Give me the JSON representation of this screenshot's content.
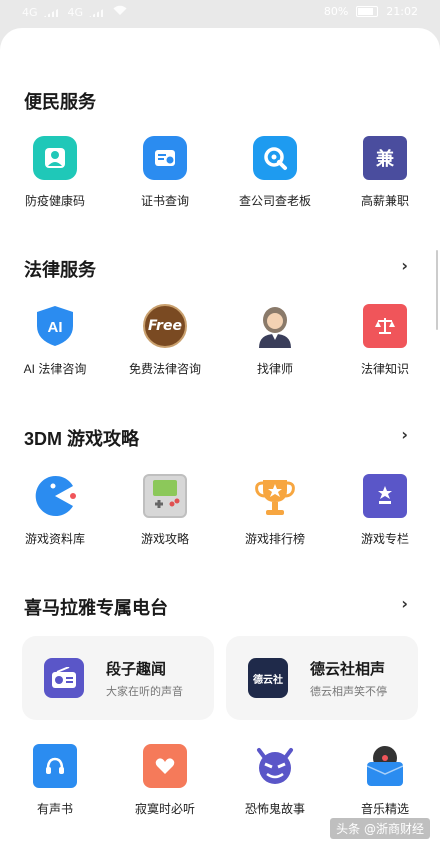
{
  "status": {
    "network": "4G",
    "network2": "4G",
    "battery": "80%",
    "time": "21:02"
  },
  "sections": {
    "service": {
      "title": "便民服务",
      "items": [
        {
          "label": "防疫健康码"
        },
        {
          "label": "证书查询"
        },
        {
          "label": "查公司查老板"
        },
        {
          "label": "高薪兼职",
          "icon_text": "兼"
        }
      ]
    },
    "legal": {
      "title": "法律服务",
      "chevron": "›",
      "items": [
        {
          "label": "AI 法律咨询",
          "icon_text": "AI"
        },
        {
          "label": "免费法律咨询",
          "icon_text": "Free"
        },
        {
          "label": "找律师"
        },
        {
          "label": "法律知识"
        }
      ]
    },
    "game": {
      "title": "3DM 游戏攻略",
      "chevron": "›",
      "items": [
        {
          "label": "游戏资料库"
        },
        {
          "label": "游戏攻略"
        },
        {
          "label": "游戏排行榜"
        },
        {
          "label": "游戏专栏"
        }
      ]
    },
    "radio": {
      "title": "喜马拉雅专属电台",
      "chevron": "›",
      "cards": [
        {
          "title": "段子趣闻",
          "subtitle": "大家在听的声音"
        },
        {
          "title": "德云社相声",
          "subtitle": "德云相声笑不停",
          "icon_text": "德云社"
        }
      ],
      "items": [
        {
          "label": "有声书"
        },
        {
          "label": "寂寞时必听"
        },
        {
          "label": "恐怖鬼故事"
        },
        {
          "label": "音乐精选"
        }
      ]
    }
  },
  "watermark": "头条 @浙商财经",
  "colors": {
    "teal": "#1fc8b8",
    "blue": "#2b8cf0",
    "navy": "#4a4d9e",
    "brown": "#7a4a22",
    "red": "#f0555a",
    "orange": "#f7a640",
    "purple": "#5a56c8"
  }
}
